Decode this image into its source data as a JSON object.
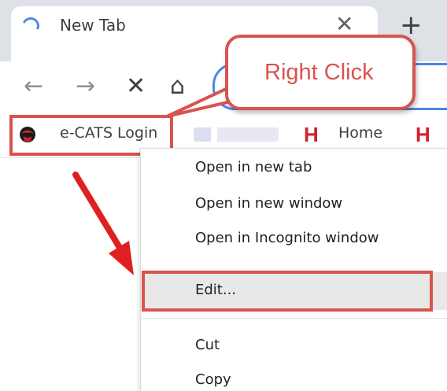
{
  "tab": {
    "title": "New Tab",
    "close_glyph": "✕",
    "new_tab_glyph": "+"
  },
  "nav": {
    "back_glyph": "←",
    "forward_glyph": "→",
    "stop_glyph": "✕",
    "home_glyph": "⌂"
  },
  "bookmarks": {
    "item1": {
      "label": "e-CATS Login"
    },
    "item3": {
      "label": "Home",
      "logo": "H"
    },
    "item4": {
      "logo": "H"
    }
  },
  "callout": {
    "text": "Right Click"
  },
  "context_menu": {
    "items": [
      "Open in new tab",
      "Open in new window",
      "Open in Incognito window",
      "Edit...",
      "Cut",
      "Copy"
    ]
  },
  "colors": {
    "highlight": "#d9534f",
    "accent_blue": "#4a86e8",
    "logo_red": "#d2232a"
  }
}
